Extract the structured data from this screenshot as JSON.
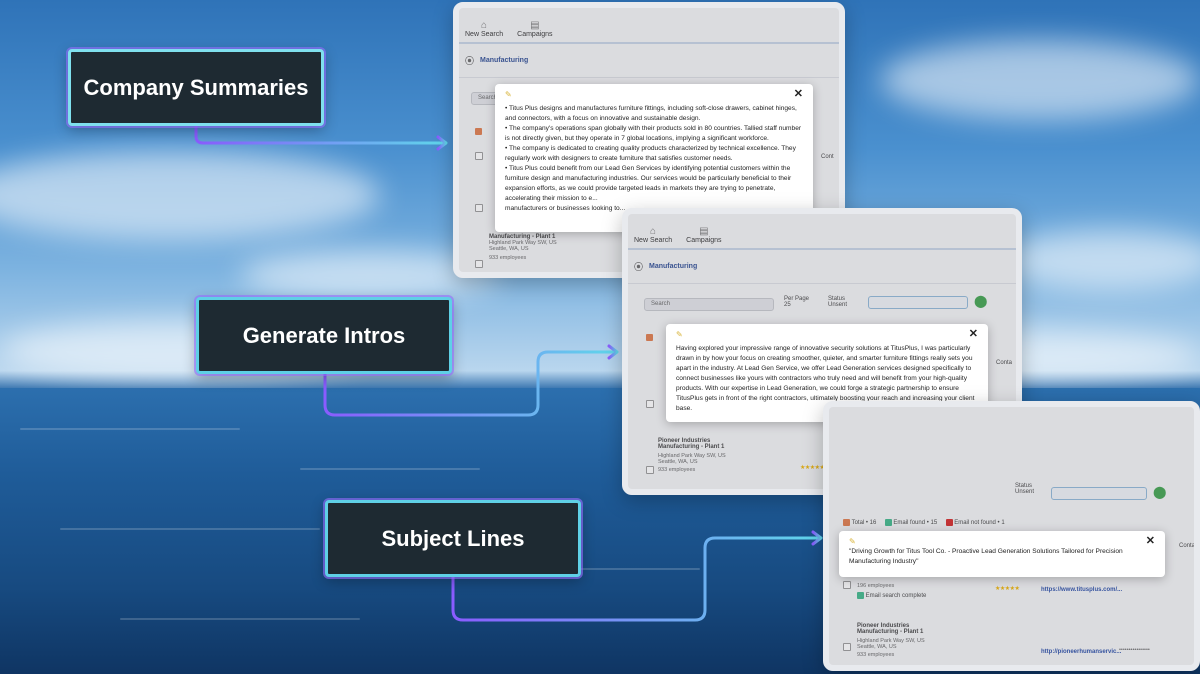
{
  "labels": {
    "company_summaries": "Company Summaries",
    "generate_intros": "Generate Intros",
    "subject_lines": "Subject Lines"
  },
  "colors": {
    "label_bg": "#1e2a32",
    "label_border": "#5fd0e6",
    "arrow": "#7a5cff",
    "arrow_end": "#5fd0e6"
  },
  "app": {
    "nav": {
      "new_search": "New Search",
      "campaigns": "Campaigns"
    },
    "location": "Manufacturing",
    "search_placeholder": "Search",
    "per_page_label": "Per Page",
    "per_page_value": "25",
    "status_label": "Status",
    "status_value": "Unsent",
    "column_contact": "Cont",
    "column_contact_full": "Conta",
    "stats": {
      "total": "Total • 16",
      "email_found": "Email found • 15",
      "email_not_found": "Email not found • 1"
    },
    "company_row": {
      "name": "Pioneer Industries",
      "sub": "Manufacturing - Plant 1",
      "address_line1": "Highland Park Way SW, US",
      "address_line2": "Seattle, WA, US",
      "employees": "933 employees",
      "url": "http://pioneerhumanservic...",
      "masked": "••••••••••••••••"
    },
    "titus_row": {
      "employees": "196 employees",
      "status": "Email search complete",
      "url": "https://www.titusplus.com/..."
    },
    "icons": {
      "home": "home-icon",
      "campaign": "campaign-icon",
      "pin": "location-pin-icon",
      "pencil": "pencil-icon",
      "close": "close-icon"
    }
  },
  "popups": {
    "summary": [
      "• Titus Plus designs and manufactures furniture fittings, including soft-close drawers, cabinet hinges, and connectors, with a focus on innovative and sustainable design.",
      "• The company's operations span globally with their products sold in 80 countries. Tallied staff number is not directly given, but they operate in 7 global locations, implying a significant workforce.",
      "• The company is dedicated to creating quality products characterized by technical excellence. They regularly work with designers to create furniture that satisfies customer needs.",
      "• Titus Plus could benefit from our Lead Gen Services by identifying potential customers within the furniture design and manufacturing industries. Our services would be particularly beneficial to their expansion efforts, as we could provide targeted leads in markets they are trying to penetrate, accelerating their mission to e...",
      "manufacturers or businesses looking to..."
    ],
    "intro": "Having explored your impressive range of innovative security solutions at TitusPlus, I was particularly drawn in by how your focus on creating smoother, quieter, and smarter furniture fittings really sets you apart in the industry. At Lead Gen Service, we offer Lead Generation services designed specifically to connect businesses like yours with contractors who truly need and will benefit from your high-quality products. With our expertise in Lead Generation, we could forge a strategic partnership to ensure TitusPlus gets in front of the right contractors, ultimately boosting your reach and increasing your client base.",
    "subject": "\"Driving Growth for Titus Tool Co. - Proactive Lead Generation Solutions Tailored for Precision Manufacturing Industry\""
  }
}
